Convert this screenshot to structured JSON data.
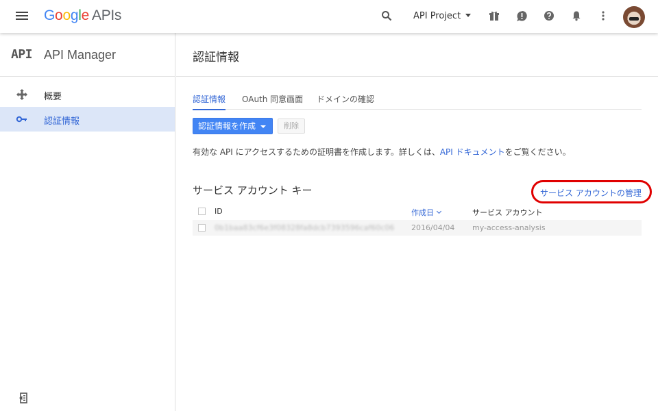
{
  "topbar": {
    "logo_google": "Google",
    "logo_apis": "APIs",
    "project_name": "API Project"
  },
  "sidebar": {
    "api_mark": "API",
    "title": "API Manager",
    "items": [
      {
        "label": "概要",
        "icon": "dashboard-icon",
        "active": false
      },
      {
        "label": "認証情報",
        "icon": "key-icon",
        "active": true
      }
    ]
  },
  "main": {
    "page_title": "認証情報",
    "tabs": [
      {
        "label": "認証情報",
        "active": true
      },
      {
        "label": "OAuth 同意画面",
        "active": false
      },
      {
        "label": "ドメインの確認",
        "active": false
      }
    ],
    "create_button": "認証情報を作成",
    "delete_button": "削除",
    "description_before": "有効な API にアクセスするための証明書を作成します。詳しくは、",
    "description_link": "API ドキュメント",
    "description_after": "をご覧ください。",
    "section_title": "サービス アカウント キー",
    "manage_link": "サービス アカウントの管理",
    "table": {
      "headers": {
        "id": "ID",
        "created": "作成日",
        "service_account": "サービス アカウント"
      },
      "rows": [
        {
          "id": "0b1baa83cf6e3f08328fa8dcb7393596caf60c06",
          "created": "2016/04/04",
          "service_account": "my-access-analysis"
        }
      ]
    }
  },
  "colors": {
    "accent": "#4285f4",
    "link": "#3367d6",
    "highlight_ring": "#e00000",
    "active_nav_bg": "#dce6f8"
  }
}
